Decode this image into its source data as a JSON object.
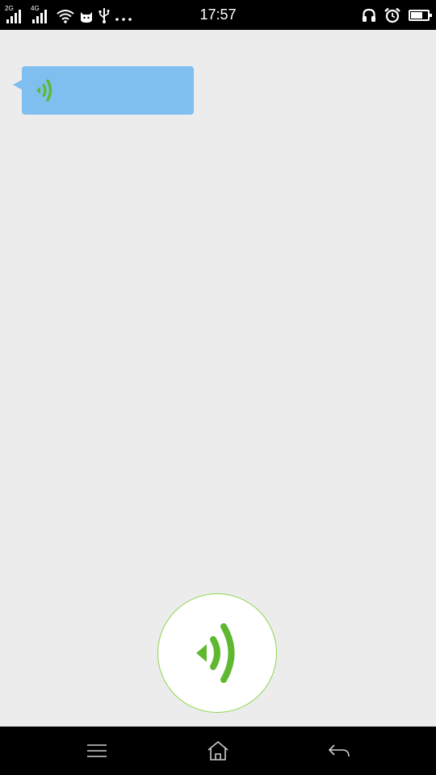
{
  "status_bar": {
    "sim1_network": "2G",
    "sim2_network": "4G",
    "time": "17:57",
    "battery_level": 0.7,
    "icons": [
      "signal-icon",
      "signal-icon",
      "wifi-icon",
      "cat-notification-icon",
      "usb-icon",
      "more-dots-icon",
      "headset-icon",
      "alarm-icon",
      "battery-icon"
    ]
  },
  "messages": [
    {
      "type": "voice",
      "icon": "voice-wave-icon"
    }
  ],
  "voice_button": {
    "icon": "voice-wave-icon"
  },
  "nav_bar": {
    "icons": [
      "menu-icon",
      "home-icon",
      "back-icon"
    ]
  },
  "colors": {
    "background": "#ececec",
    "bubble": "#7fbfef",
    "accent_green": "#5fb830",
    "button_border": "#8ed64c"
  }
}
